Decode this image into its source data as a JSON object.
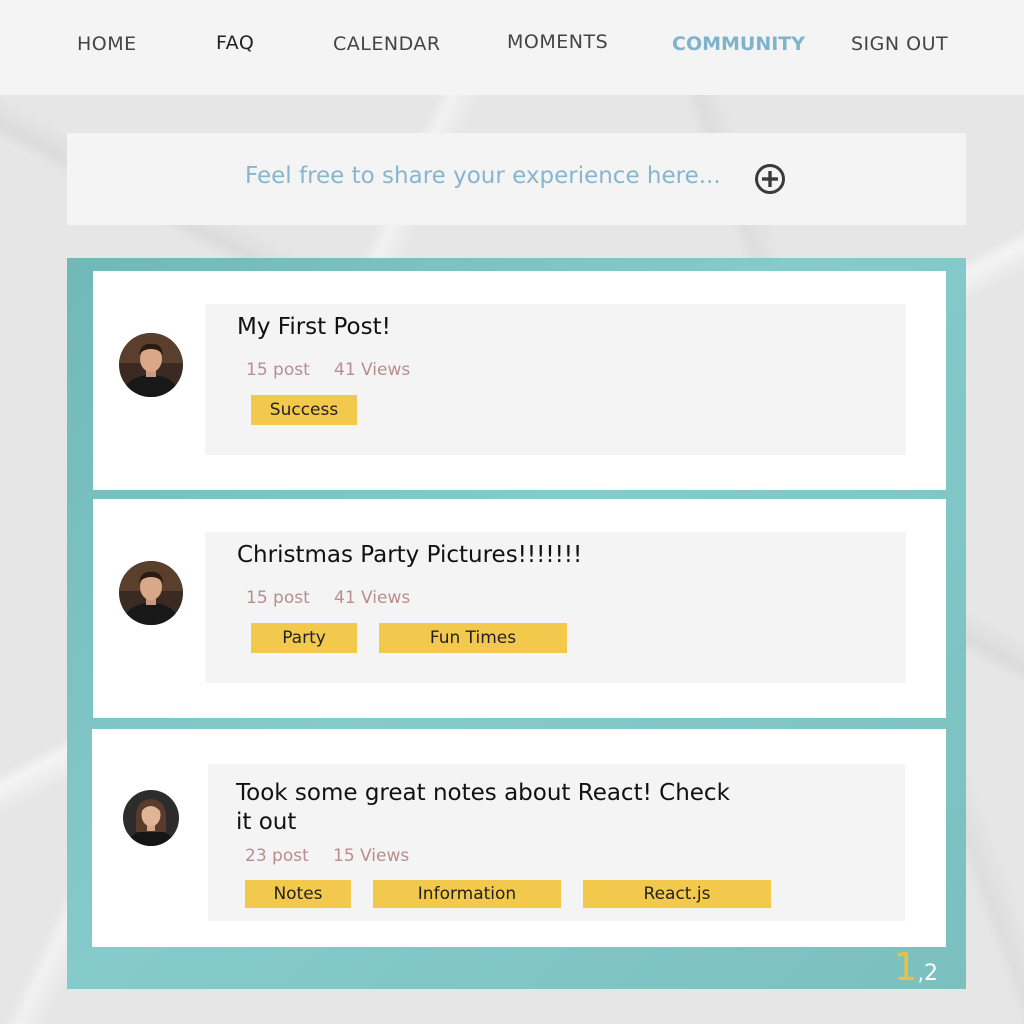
{
  "nav": {
    "items": [
      {
        "label": "HOME"
      },
      {
        "label": "FAQ"
      },
      {
        "label": "CALENDAR"
      },
      {
        "label": "MOMENTS"
      },
      {
        "label": "COMMUNITY"
      },
      {
        "label": "SIGN OUT"
      }
    ],
    "active": "COMMUNITY"
  },
  "share": {
    "prompt": "Feel free to share your experience here..."
  },
  "posts": [
    {
      "title": "My First Post!",
      "post_count": "15 post",
      "views": "41 Views",
      "tags": [
        "Success"
      ]
    },
    {
      "title": "Christmas Party Pictures!!!!!!!",
      "post_count": "15 post",
      "views": "41 Views",
      "tags": [
        "Party",
        "Fun Times"
      ]
    },
    {
      "title_line1": "Took some great notes about React! Check",
      "title_line2": "it out",
      "post_count": "23 post",
      "views": "15 Views",
      "tags": [
        "Notes",
        "Information",
        "React.js"
      ]
    }
  ],
  "pagination": {
    "current": "1",
    "separator": ",",
    "next": "2"
  },
  "colors": {
    "accent_blue": "#7fb3cc",
    "tag_yellow": "#f2c94c",
    "feed_teal": "#7fc4c4",
    "meta_pink": "#b98d90"
  }
}
